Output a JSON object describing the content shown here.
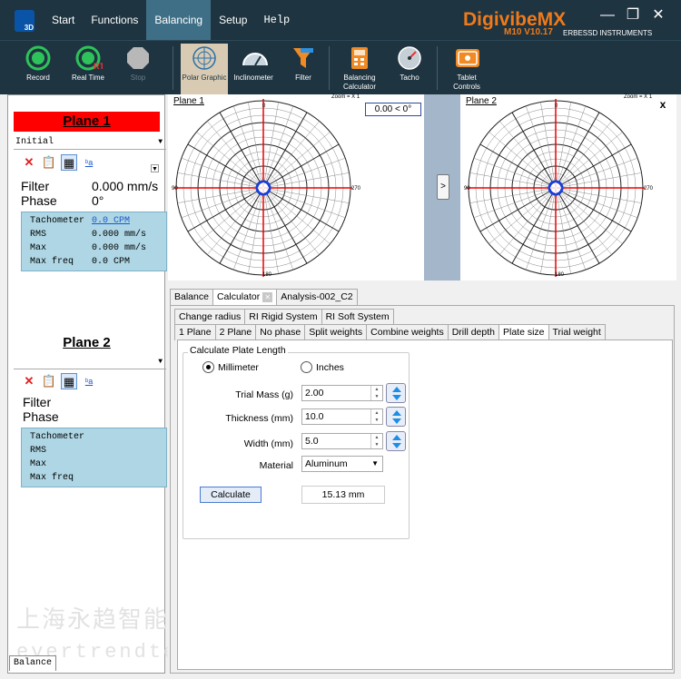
{
  "app": {
    "menu": [
      "Start",
      "Functions",
      "Balancing",
      "Setup",
      "Help"
    ],
    "active_menu": "Balancing",
    "brand": "DigivibeMX",
    "version": "M10 V10.17",
    "company": "ERBESSD INSTRUMENTS",
    "icon_text": "3D"
  },
  "toolbar": {
    "record": "Record",
    "realtime": "Real Time",
    "stop": "Stop",
    "polar_graphic": "Polar Graphic",
    "inclinometer": "Inclinometer",
    "filter": "Filter",
    "balancing_calculator": "Balancing Calculator",
    "tacho": "Tacho",
    "tablet_controls": "Tablet Controls"
  },
  "plane1": {
    "title": "Plane 1",
    "selection": "Initial",
    "filter_label": "Filter",
    "filter_value": "0.000 mm/s",
    "phase_label": "Phase",
    "phase_value": "0°",
    "tachometer_label": "Tachometer",
    "tachometer_value": "0.0 CPM",
    "rms_label": "RMS",
    "rms_value": "0.000 mm/s",
    "max_label": "Max",
    "max_value": "0.000 mm/s",
    "maxfreq_label": "Max freq",
    "maxfreq_value": "0.0 CPM"
  },
  "plane2": {
    "title": "Plane 2",
    "filter_label": "Filter",
    "phase_label": "Phase",
    "tachometer_label": "Tachometer",
    "rms_label": "RMS",
    "max_label": "Max",
    "maxfreq_label": "Max freq"
  },
  "bottom_tab": "Balance",
  "polar": {
    "left_title": "Plane 1",
    "right_title": "Plane 2",
    "zoom": "Zoom = X 1",
    "phase_readout": "0.00 < 0°",
    "angle_0": "0",
    "angle_90": "90",
    "angle_180": "180",
    "angle_270": "270",
    "expand": ">",
    "close": "x"
  },
  "tabs_main": [
    "Balance",
    "Calculator",
    "Analysis-002_C2"
  ],
  "tabs_calc_row1": [
    "Change radius",
    "RI Rigid System",
    "RI Soft System"
  ],
  "tabs_calc_row2": [
    "1 Plane",
    "2 Plane",
    "No phase",
    "Split weights",
    "Combine weights",
    "Drill depth",
    "Plate size",
    "Trial weight"
  ],
  "plate": {
    "group_title": "Calculate Plate Length",
    "unit_mm": "Millimeter",
    "unit_in": "Inches",
    "trial_mass_label": "Trial Mass (g)",
    "trial_mass": "2.00",
    "thickness_label": "Thickness (mm)",
    "thickness": "10.0",
    "width_label": "Width (mm)",
    "width": "5.0",
    "material_label": "Material",
    "material": "Aluminum",
    "calculate": "Calculate",
    "result": "15.13 mm"
  },
  "watermark": {
    "line1": "上海永趋智能科技有限公司",
    "line2": "evertrendtech.cn.china.cn"
  }
}
